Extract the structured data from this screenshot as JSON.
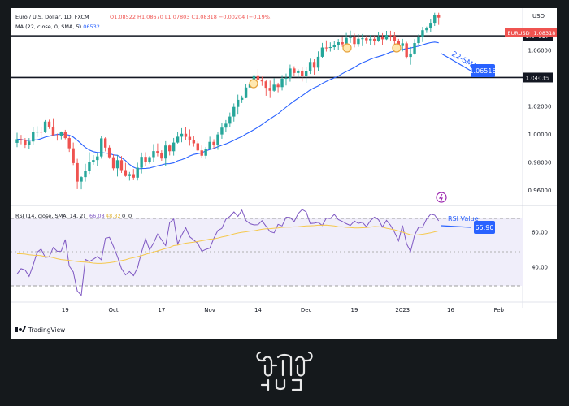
{
  "header": {
    "symbol": "Euro / U.S. Dollar, 1D, FXCM",
    "ohlc": "O1.08522  H1.08670  L1.07803  C1.08318  −0.00204 (−0.19%)",
    "ma_line": "MA (22, close, 0, SMA, 5)",
    "ma_value": "1.06532",
    "currency": "USD"
  },
  "labels": {
    "symbol_tag": "EURUSD",
    "price_tag": "1.08318",
    "sma_annotation": "22-SMA",
    "sma_tag": "1.06516",
    "rsi_header": "RSI (14, close, SMA, 14, 2)",
    "rsi_v1": "66.08",
    "rsi_v2": "48.82",
    "rsi_v3": "0",
    "rsi_v4": "0",
    "rsi_annotation": "RSI Value",
    "rsi_tag": "65.90",
    "brand": "TradingView"
  },
  "colors": {
    "up": "#26a69a",
    "down": "#ef5350",
    "sma": "#2962ff",
    "rsi": "#7e57c2",
    "rsi_sma": "#f5c84c",
    "annotation": "#2962ff"
  },
  "chart_data": {
    "type": "candlestick",
    "levels": [
      "1.07017",
      "1.04035"
    ],
    "price_ylim": [
      0.95,
      1.09
    ],
    "price_ticks": [
      "1.06000",
      "1.04000",
      "1.02000",
      "1.00000",
      "0.98000",
      "0.96000"
    ],
    "rsi_ylim": [
      20,
      75
    ],
    "rsi_ticks": [
      "60.00",
      "40.00"
    ],
    "x_ticks": [
      "19",
      "Oct",
      "17",
      "Nov",
      "14",
      "Dec",
      "19",
      "2023",
      "16",
      "Feb"
    ],
    "x_tick_index": [
      12,
      24,
      36,
      48,
      60,
      72,
      84,
      96,
      108,
      120
    ],
    "candles": [
      [
        0.9936,
        1.0008,
        0.9905,
        0.9962
      ],
      [
        0.9962,
        0.9993,
        0.9926,
        0.9956
      ],
      [
        0.9956,
        0.997,
        0.99,
        0.9923
      ],
      [
        0.9923,
        0.997,
        0.9895,
        0.9946
      ],
      [
        0.9946,
        1.0047,
        0.9921,
        1.0016
      ],
      [
        1.0016,
        1.0055,
        0.9977,
        1.0016
      ],
      [
        1.0016,
        1.0049,
        0.9977,
        1.0013
      ],
      [
        1.0013,
        1.0099,
        1.0007,
        1.0088
      ],
      [
        1.0088,
        1.0102,
        1.0036,
        1.0052
      ],
      [
        1.0052,
        1.0112,
        1.0014,
        0.9989
      ],
      [
        0.9989,
        1.0002,
        0.9952,
        0.9983
      ],
      [
        0.9983,
        1.0018,
        0.9961,
        1.0015
      ],
      [
        1.0015,
        1.0029,
        0.9961,
        0.997
      ],
      [
        0.997,
        0.9983,
        0.9871,
        0.9897
      ],
      [
        0.9897,
        0.9938,
        0.9777,
        0.9791
      ],
      [
        0.9791,
        0.9822,
        0.9605,
        0.9659
      ],
      [
        0.9659,
        0.9697,
        0.9604,
        0.9691
      ],
      [
        0.9691,
        0.9786,
        0.9659,
        0.9735
      ],
      [
        0.9735,
        0.9869,
        0.9714,
        0.9798
      ],
      [
        0.9798,
        0.9849,
        0.9779,
        0.9813
      ],
      [
        0.9813,
        0.986,
        0.9771,
        0.9839
      ],
      [
        0.9839,
        0.9983,
        0.9823,
        0.9968
      ],
      [
        0.9968,
        0.9976,
        0.9875,
        0.9902
      ],
      [
        0.9902,
        0.9917,
        0.9822,
        0.9833
      ],
      [
        0.9833,
        0.9854,
        0.9741,
        0.9754
      ],
      [
        0.9754,
        0.9849,
        0.9695,
        0.9812
      ],
      [
        0.9812,
        0.9842,
        0.9721,
        0.9741
      ],
      [
        0.9741,
        0.9793,
        0.9693,
        0.9699
      ],
      [
        0.9699,
        0.9728,
        0.9666,
        0.9712
      ],
      [
        0.9712,
        0.9749,
        0.9669,
        0.9687
      ],
      [
        0.9687,
        0.9794,
        0.9667,
        0.9758
      ],
      [
        0.9758,
        0.9867,
        0.9717,
        0.9836
      ],
      [
        0.9836,
        0.9869,
        0.9768,
        0.9797
      ],
      [
        0.9797,
        0.9841,
        0.9787,
        0.9834
      ],
      [
        0.9834,
        0.9927,
        0.9798,
        0.9877
      ],
      [
        0.9877,
        0.9932,
        0.9839,
        0.9863
      ],
      [
        0.9863,
        0.9883,
        0.9808,
        0.9824
      ],
      [
        0.9824,
        0.9948,
        0.9773,
        0.9917
      ],
      [
        0.9917,
        0.9926,
        0.9846,
        0.9876
      ],
      [
        0.9876,
        0.9971,
        0.9845,
        0.9938
      ],
      [
        0.9938,
        1.0017,
        0.9931,
        0.998
      ],
      [
        0.998,
        1.0041,
        0.994,
        1.0001
      ],
      [
        1.0001,
        1.0051,
        0.9953,
        0.9979
      ],
      [
        0.9979,
        1.0032,
        0.9916,
        0.9956
      ],
      [
        0.9956,
        0.9983,
        0.9909,
        0.9933
      ],
      [
        0.9933,
        0.9946,
        0.9876,
        0.9882
      ],
      [
        0.9882,
        0.9917,
        0.9826,
        0.9844
      ],
      [
        0.9844,
        0.9907,
        0.9821,
        0.9895
      ],
      [
        0.9895,
        0.998,
        0.9891,
        0.9943
      ],
      [
        0.9943,
        0.9962,
        0.9896,
        0.9923
      ],
      [
        0.9923,
        1.0016,
        0.9886,
        0.9996
      ],
      [
        0.9996,
        1.0079,
        0.9965,
        1.0045
      ],
      [
        1.0045,
        1.0099,
        1.0011,
        1.0073
      ],
      [
        1.0073,
        1.0153,
        1.0048,
        1.0124
      ],
      [
        1.0124,
        1.0218,
        1.0088,
        1.0193
      ],
      [
        1.0193,
        1.0281,
        1.0138,
        1.0244
      ],
      [
        1.0244,
        1.0274,
        1.0221,
        1.0257
      ],
      [
        1.0257,
        1.0356,
        1.0255,
        1.0332
      ],
      [
        1.0332,
        1.0409,
        1.031,
        1.0357
      ],
      [
        1.0357,
        1.0457,
        1.0317,
        1.0419
      ],
      [
        1.0419,
        1.0464,
        1.0355,
        1.0386
      ],
      [
        1.0386,
        1.041,
        1.0344,
        1.0376
      ],
      [
        1.0376,
        1.0389,
        1.0273,
        1.033
      ],
      [
        1.033,
        1.0381,
        1.0257,
        1.0309
      ],
      [
        1.0309,
        1.0398,
        1.0302,
        1.0352
      ],
      [
        1.0352,
        1.0366,
        1.0298,
        1.0335
      ],
      [
        1.0335,
        1.0421,
        1.0311,
        1.0395
      ],
      [
        1.0395,
        1.0432,
        1.0347,
        1.0401
      ],
      [
        1.0401,
        1.0496,
        1.0374,
        1.0468
      ],
      [
        1.0468,
        1.0484,
        1.0418,
        1.0436
      ],
      [
        1.0436,
        1.0463,
        1.0403,
        1.0453
      ],
      [
        1.0453,
        1.0477,
        1.0375,
        1.0412
      ],
      [
        1.0412,
        1.0481,
        1.0366,
        1.0452
      ],
      [
        1.0452,
        1.0538,
        1.0429,
        1.0515
      ],
      [
        1.0515,
        1.0534,
        1.0424,
        1.0474
      ],
      [
        1.0474,
        1.0591,
        1.0449,
        1.0552
      ],
      [
        1.0552,
        1.0651,
        1.0545,
        1.0618
      ],
      [
        1.0618,
        1.0669,
        1.0589,
        1.0615
      ],
      [
        1.0615,
        1.0655,
        1.0589,
        1.0621
      ],
      [
        1.0621,
        1.0662,
        1.0601,
        1.0634
      ],
      [
        1.0634,
        1.0679,
        1.0599,
        1.0656
      ],
      [
        1.0656,
        1.0692,
        1.0623,
        1.0641
      ],
      [
        1.0641,
        1.0722,
        1.062,
        1.0687
      ],
      [
        1.0687,
        1.0739,
        1.0651,
        1.0692
      ],
      [
        1.0692,
        1.0718,
        1.0619,
        1.0643
      ],
      [
        1.0643,
        1.0714,
        1.0623,
        1.0681
      ],
      [
        1.0681,
        1.0715,
        1.0628,
        1.0684
      ],
      [
        1.0684,
        1.0701,
        1.0646,
        1.067
      ],
      [
        1.067,
        1.0708,
        1.0637,
        1.068
      ],
      [
        1.068,
        1.0702,
        1.0632,
        1.0667
      ],
      [
        1.0667,
        1.0726,
        1.0658,
        1.0694
      ],
      [
        1.0694,
        1.0721,
        1.0637,
        1.0677
      ],
      [
        1.0677,
        1.0737,
        1.0672,
        1.0708
      ],
      [
        1.0708,
        1.0738,
        1.0668,
        1.0701
      ],
      [
        1.0701,
        1.0726,
        1.0638,
        1.0665
      ],
      [
        1.0665,
        1.068,
        1.0619,
        1.0629
      ],
      [
        1.0629,
        1.068,
        1.059,
        1.0648
      ],
      [
        1.0648,
        1.0659,
        1.0538,
        1.0551
      ],
      [
        1.0551,
        1.0622,
        1.0495,
        1.0575
      ],
      [
        1.0575,
        1.0678,
        1.0567,
        1.065
      ],
      [
        1.065,
        1.0712,
        1.0635,
        1.0693
      ],
      [
        1.0693,
        1.0766,
        1.0657,
        1.0742
      ],
      [
        1.0742,
        1.0768,
        1.0722,
        1.0755
      ],
      [
        1.0755,
        1.0819,
        1.0726,
        1.0795
      ],
      [
        1.0795,
        1.0867,
        1.0772,
        1.0852
      ],
      [
        1.0852,
        1.0867,
        1.078,
        1.0832
      ]
    ],
    "sma": [
      0.9962,
      0.9961,
      0.9953,
      0.9953,
      0.9957,
      0.9957,
      0.9966,
      0.9977,
      0.9984,
      0.9991,
      0.9996,
      0.9999,
      0.9996,
      0.9991,
      0.9977,
      0.9954,
      0.9929,
      0.9903,
      0.9885,
      0.9873,
      0.9867,
      0.9866,
      0.9863,
      0.986,
      0.985,
      0.9847,
      0.983,
      0.9809,
      0.9782,
      0.9762,
      0.975,
      0.9752,
      0.9753,
      0.9756,
      0.9764,
      0.9772,
      0.9778,
      0.9786,
      0.9787,
      0.9793,
      0.9808,
      0.9816,
      0.9827,
      0.9842,
      0.9853,
      0.9859,
      0.9865,
      0.9879,
      0.9888,
      0.9896,
      0.9908,
      0.9919,
      0.9929,
      0.9941,
      0.9954,
      0.9969,
      0.9981,
      0.9999,
      1.0014,
      1.0031,
      1.0048,
      1.0067,
      1.0088,
      1.0107,
      1.0126,
      1.0144,
      1.0168,
      1.0191,
      1.0214,
      1.0236,
      1.0255,
      1.0274,
      1.0294,
      1.0315,
      1.033,
      1.0343,
      1.0361,
      1.0376,
      1.0389,
      1.0401,
      1.0414,
      1.0431,
      1.0447,
      1.0461,
      1.0476,
      1.0494,
      1.0509,
      1.0521,
      1.0534,
      1.0545,
      1.0553,
      1.0562,
      1.0573,
      1.0585,
      1.0592,
      1.0598,
      1.0603,
      1.0612,
      1.0614,
      1.0622,
      1.0628,
      1.0637,
      1.0646,
      1.0653,
      1.0657,
      1.0652
    ],
    "rsi": [
      36.0,
      39.0,
      38.2,
      34.6,
      41.1,
      48.4,
      50.2,
      45.4,
      45.7,
      51.1,
      48.9,
      49.0,
      55.6,
      40.5,
      37.1,
      26.3,
      23.9,
      44.3,
      43.1,
      44.4,
      45.9,
      44.1,
      56.3,
      56.9,
      51.6,
      45.9,
      39.1,
      35.5,
      37.4,
      35.0,
      39.5,
      48.4,
      56.0,
      49.7,
      53.6,
      58.7,
      55.4,
      52.1,
      65.2,
      67.3,
      53.0,
      58.1,
      62.3,
      57.1,
      55.3,
      53.4,
      48.9,
      50.0,
      50.7,
      56.3,
      60.7,
      61.9,
      67.2,
      68.7,
      71.3,
      68.8,
      72.3,
      66.4,
      64.6,
      63.9,
      64.0,
      66.3,
      63.1,
      60.1,
      59.4,
      64.2,
      63.3,
      68.3,
      68.1,
      65.8,
      70.4,
      72.7,
      71.3,
      64.7,
      64.9,
      65.4,
      63.6,
      67.8,
      67.5,
      69.9,
      66.9,
      65.9,
      64.6,
      63.6,
      66.1,
      64.8,
      65.4,
      62.9,
      66.3,
      68.3,
      66.9,
      62.7,
      66.5,
      63.7,
      59.7,
      54.8,
      63.6,
      53.2,
      48.8,
      58.1,
      62.6,
      62.5,
      67.3,
      70.0,
      69.5,
      66.2
    ],
    "rsi_sma": [
      47.5,
      47.5,
      47.3,
      46.9,
      46.7,
      46.6,
      46.4,
      45.9,
      45.8,
      45.3,
      44.7,
      44.2,
      44.0,
      43.7,
      43.4,
      43.1,
      42.9,
      42.8,
      42.5,
      42.2,
      42.0,
      42.0,
      42.2,
      42.4,
      42.8,
      43.2,
      43.6,
      44.1,
      44.8,
      45.3,
      45.9,
      46.4,
      47.2,
      47.8,
      48.5,
      49.1,
      49.8,
      50.5,
      51.1,
      52.1,
      52.4,
      53.0,
      53.5,
      53.8,
      54.1,
      54.5,
      54.9,
      55.3,
      55.8,
      55.9,
      56.4,
      57.0,
      57.5,
      58.1,
      58.8,
      59.3,
      59.7,
      60.0,
      60.4,
      60.6,
      61.0,
      61.4,
      61.7,
      61.8,
      62.0,
      62.2,
      62.5,
      62.6,
      62.6,
      62.8,
      62.9,
      63.1,
      63.3,
      63.4,
      63.5,
      63.7,
      63.7,
      63.8,
      63.6,
      63.3,
      62.9,
      62.8,
      62.5,
      62.4,
      62.2,
      62.2,
      62.3,
      62.4,
      62.7,
      63.0,
      62.9,
      62.6,
      62.0,
      61.6,
      61.1,
      60.5,
      59.8,
      59.0,
      58.3,
      58.1,
      58.3,
      58.6,
      59.0,
      59.4,
      60.0,
      60.5
    ]
  }
}
